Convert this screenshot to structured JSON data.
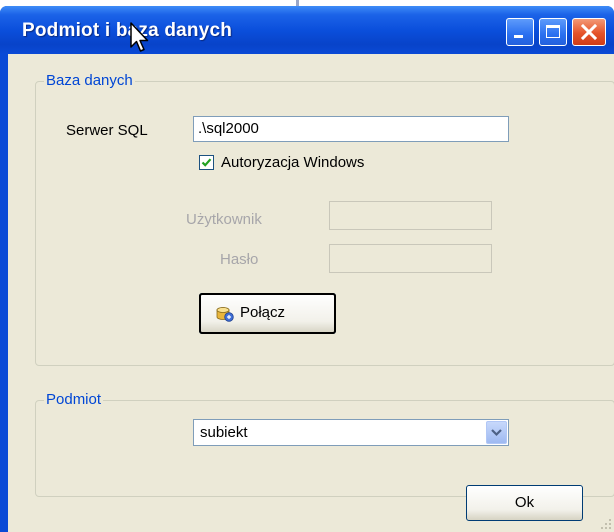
{
  "window": {
    "title": "Podmiot i baza danych",
    "title_color": "#ffffff",
    "titlebar_color": "#0a4ad6"
  },
  "database_group": {
    "legend": "Baza danych",
    "sql_server_label": "Serwer SQL",
    "sql_server_value": ".\\sql2000",
    "windows_auth_label": "Autoryzacja Windows",
    "windows_auth_checked": true,
    "user_label": "Użytkownik",
    "user_value": "",
    "password_label": "Hasło",
    "password_value": "",
    "connect_button_label": "Połącz",
    "connect_icon": "database-connect-icon"
  },
  "subject_group": {
    "legend": "Podmiot",
    "selected_subject": "subiekt"
  },
  "ok_button_label": "Ok",
  "colors": {
    "legend": "#0046d5",
    "face": "#ece9d8",
    "close": "#e5532a"
  }
}
